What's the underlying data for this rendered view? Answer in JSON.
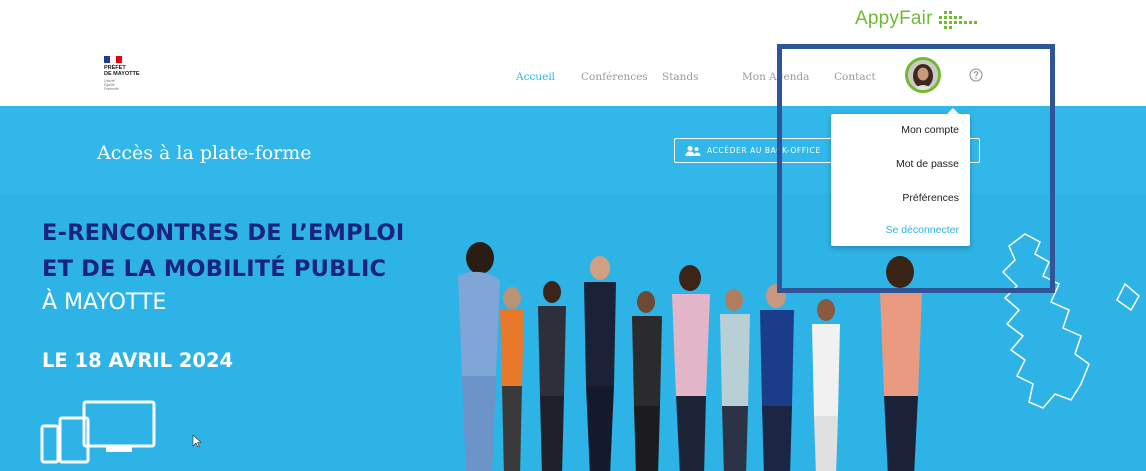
{
  "brand": {
    "name": "AppyFair",
    "color": "#6dbb2f"
  },
  "logo": {
    "title_lines": [
      "PRÉFET",
      "DE MAYOTTE"
    ],
    "motto_lines": [
      "Liberté",
      "Égalité",
      "Fraternité"
    ]
  },
  "nav": {
    "items": [
      {
        "label": "Accueil",
        "active": true
      },
      {
        "label": "Conférences",
        "active": false
      },
      {
        "label": "Stands",
        "active": false
      },
      {
        "label": "Mon Agenda",
        "active": false
      },
      {
        "label": "Contact",
        "active": false
      }
    ],
    "active_color": "#27b5e8",
    "help_icon": "help-circle-icon",
    "avatar_border_color": "#6dbb2f"
  },
  "hero": {
    "background": "#2eb3e7",
    "access_title": "Accès à la plate-forme",
    "backoffice_button": "ACCÉDER AU BACK-OFFICE",
    "headline_line1": "E-RENCONTRES DE L’EMPLOI",
    "headline_line2": "ET DE LA MOBILITÉ PUBLIC",
    "headline_line3": "À MAYOTTE",
    "date": "LE 18 AVRIL 2024",
    "headline_color": "#1a237e"
  },
  "account_menu": {
    "items": [
      {
        "label": "Mon compte"
      },
      {
        "label": "Mot de passe"
      },
      {
        "label": "Préférences"
      },
      {
        "label": "Se déconnecter",
        "color": "#27b5e8"
      }
    ]
  },
  "annotation": {
    "border_color": "#2f5597"
  }
}
